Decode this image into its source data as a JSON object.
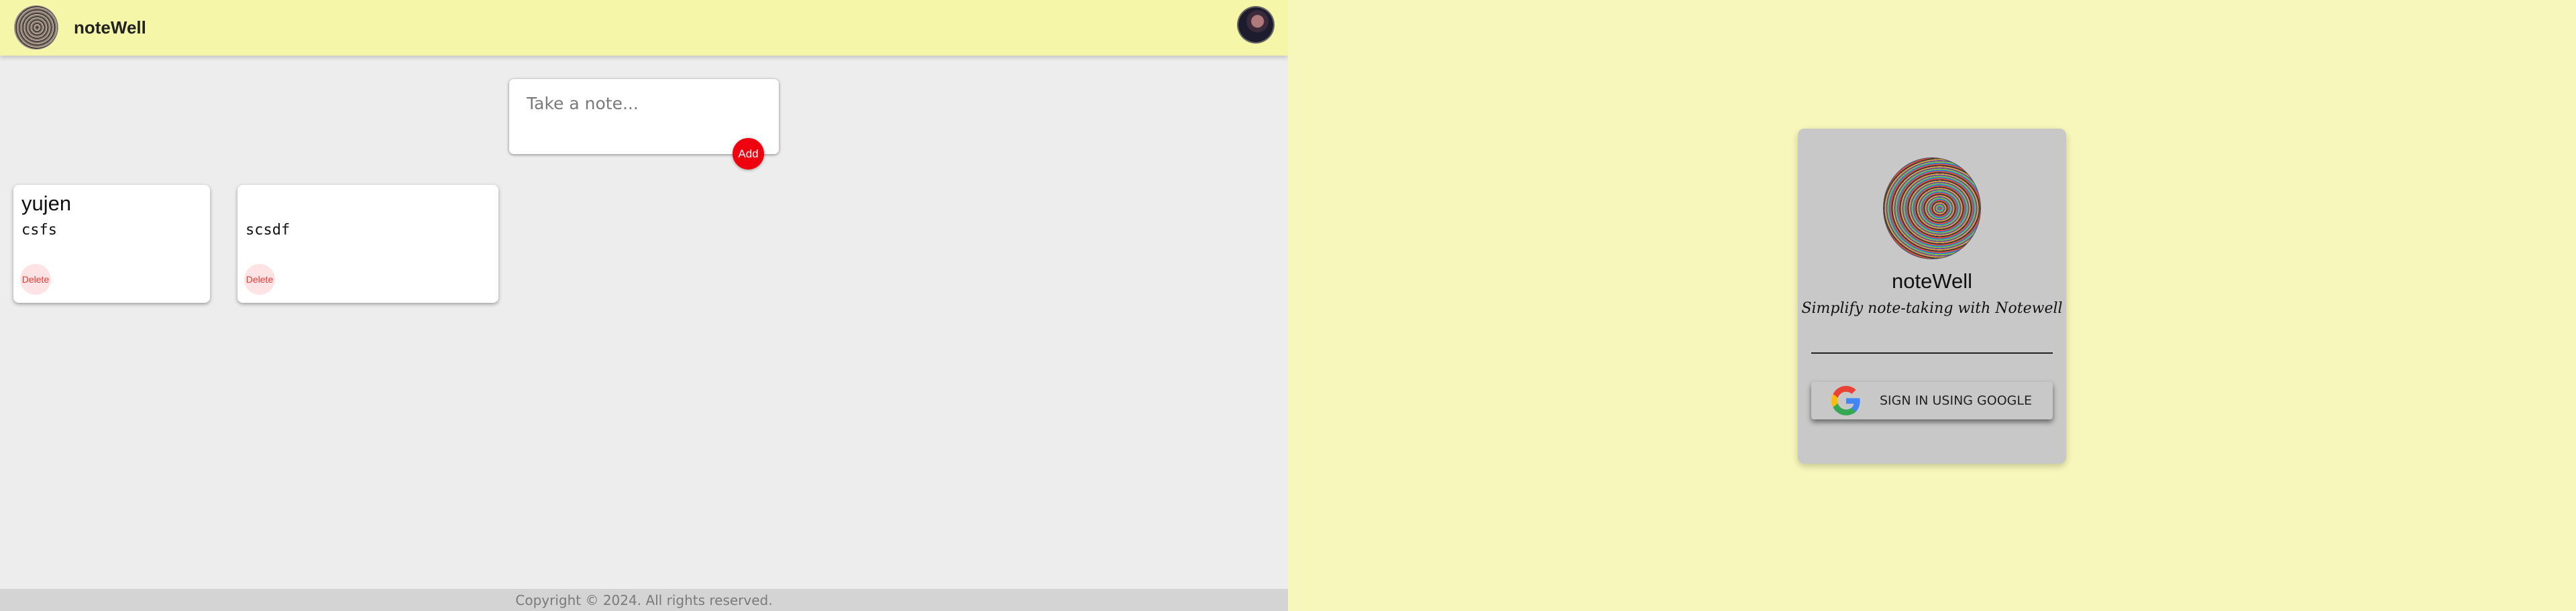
{
  "header": {
    "title": "noteWell",
    "logo_icon": "spiral-logo-icon",
    "avatar_icon": "user-avatar"
  },
  "composer": {
    "placeholder": "Take a note...",
    "add_label": "Add"
  },
  "notes": [
    {
      "title": "yujen",
      "body": "csfs",
      "delete_label": "Delete"
    },
    {
      "title": "",
      "body": "scsdf",
      "delete_label": "Delete"
    }
  ],
  "footer": {
    "copyright": "Copyright © 2024. All rights reserved."
  },
  "signin": {
    "title": "noteWell",
    "tagline": "Simplify note-taking with Notewell",
    "button_label": "SIGN IN USING GOOGLE",
    "button_icon": "google-icon"
  },
  "colors": {
    "header_bg": "#f6f6a8",
    "page_bg": "#ededed",
    "add_button": "#f0000f",
    "delete_text": "#e53935",
    "signin_bg": "#f7f7bb",
    "signin_card": "#c8c8c8"
  }
}
